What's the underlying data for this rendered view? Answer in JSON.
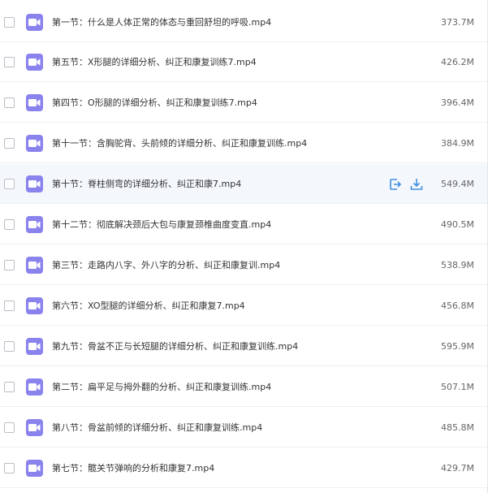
{
  "files": [
    {
      "name": "第一节：什么是人体正常的体态与重回舒坦的呼吸.mp4",
      "size": "373.7M"
    },
    {
      "name": "第五节：X形腿的详细分析、纠正和康复训练7.mp4",
      "size": "426.2M"
    },
    {
      "name": "第四节：O形腿的详细分析、纠正和康复训练7.mp4",
      "size": "396.4M"
    },
    {
      "name": "第十一节：含胸驼背、头前倾的详细分析、纠正和康复训练.mp4",
      "size": "384.9M"
    },
    {
      "name": "第十节：脊柱侧弯的详细分析、纠正和康7.mp4",
      "size": "549.4M",
      "hover": true
    },
    {
      "name": "第十二节：彻底解决颈后大包与康复颈椎曲度变直.mp4",
      "size": "490.5M"
    },
    {
      "name": "第三节：走路内八字、外八字的分析、纠正和康复训.mp4",
      "size": "538.9M"
    },
    {
      "name": "第六节：XO型腿的详细分析、纠正和康复7.mp4",
      "size": "456.8M"
    },
    {
      "name": "第九节：骨盆不正与长短腿的详细分析、纠正和康复训练.mp4",
      "size": "595.9M"
    },
    {
      "name": "第二节：扁平足与拇外翻的分析、纠正和康复训练.mp4",
      "size": "507.1M"
    },
    {
      "name": "第八节：骨盆前倾的详细分析、纠正和康复训练.mp4",
      "size": "485.8M"
    },
    {
      "name": "第七节：髋关节弹响的分析和康复7.mp4",
      "size": "429.7M"
    }
  ],
  "icons": {
    "file": "video-file-icon",
    "open": "open-icon",
    "download": "download-icon"
  },
  "colors": {
    "video_icon": "#8a83ee",
    "action_icon": "#3f8fe0",
    "hover_row": "#f4f8fd"
  }
}
